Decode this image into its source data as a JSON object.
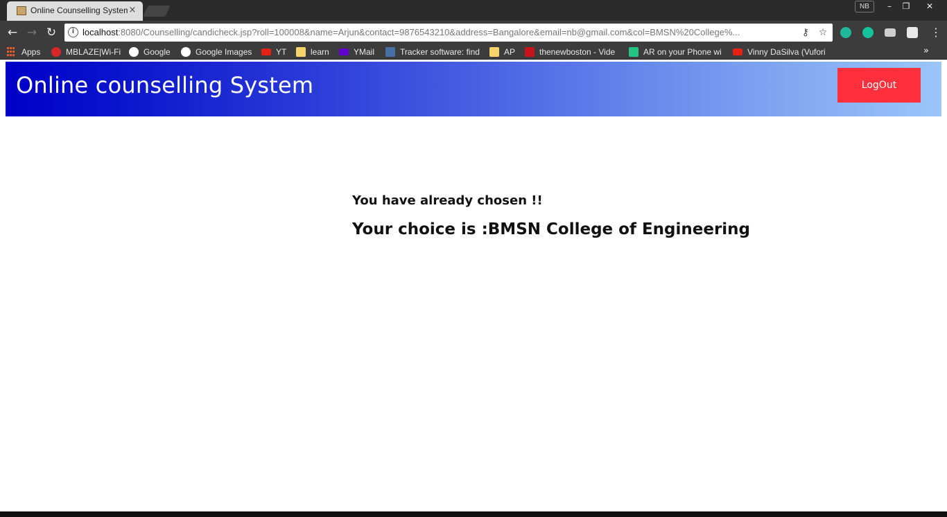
{
  "browser": {
    "tab_title": "Online Counselling System",
    "tab_close": "×",
    "profile_badge": "NB",
    "window_buttons": {
      "minimize": "–",
      "restore": "❐",
      "close": "✕"
    },
    "nav": {
      "back": "←",
      "forward": "→",
      "reload": "↻"
    },
    "url_host": "localhost",
    "url_rest": ":8080/Counselling/candicheck.jsp?roll=100008&name=Arjun&contact=9876543210&address=Bangalore&email=nb@gmail.com&col=BMSN%20College%...",
    "bookmarks": [
      {
        "label": "Apps",
        "icon": "apps-grid-icon"
      },
      {
        "label": "MBLAZE|Wi-Fi",
        "icon": "opera-icon",
        "color": "#d9262b"
      },
      {
        "label": "Google",
        "icon": "google-icon",
        "color": "#ffffff"
      },
      {
        "label": "Google Images",
        "icon": "google-icon",
        "color": "#ffffff"
      },
      {
        "label": "YT",
        "icon": "youtube-icon",
        "color": "#e62117"
      },
      {
        "label": "learn",
        "icon": "folder-icon",
        "color": "#f5d36b"
      },
      {
        "label": "YMail",
        "icon": "ymail-icon",
        "color": "#5f01d1"
      },
      {
        "label": "Tracker software: find",
        "icon": "tracker-icon",
        "color": "#4a6fa5"
      },
      {
        "label": "AP",
        "icon": "folder-icon",
        "color": "#f5d36b"
      },
      {
        "label": "thenewboston - Vide",
        "icon": "thenewboston-icon",
        "color": "#c7131c"
      },
      {
        "label": "AR on your Phone wi",
        "icon": "ar-icon",
        "color": "#26c281"
      },
      {
        "label": "Vinny DaSilva (Vufori",
        "icon": "youtube-icon",
        "color": "#e62117"
      }
    ],
    "bookmarks_overflow": "»"
  },
  "page": {
    "site_title": "Online counselling System",
    "logout_label": "LogOut",
    "already_chosen": "You have already chosen !!",
    "choice_text": "Your choice is :BMSN College of Engineering"
  },
  "colors": {
    "header_gradient_start": "#0000c8",
    "header_gradient_end": "#9ac6fa",
    "logout_button": "#ff2f3b"
  }
}
